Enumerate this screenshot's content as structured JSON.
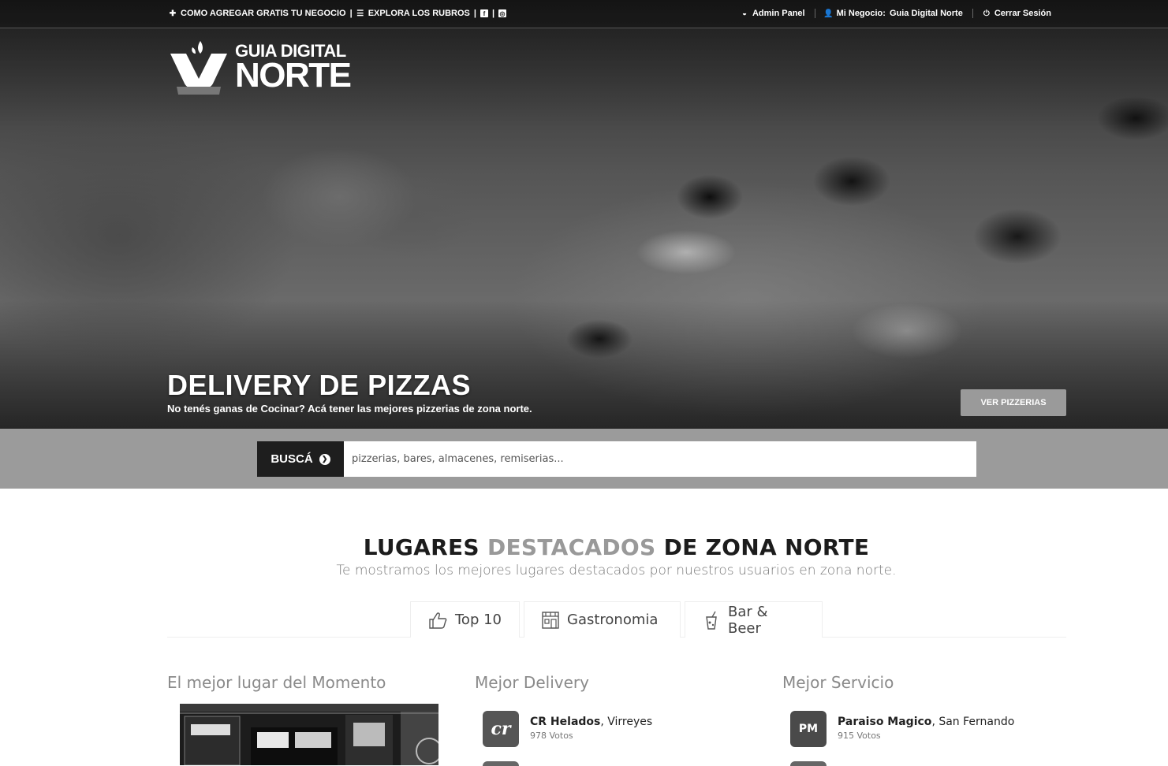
{
  "topbar": {
    "add_business": "COMO AGREGAR GRATIS TU NEGOCIO",
    "explore": "EXPLORA LOS RUBROS",
    "admin_panel": "Admin Panel",
    "my_business_label": "Mi Negocio:",
    "my_business_name": "Guia Digital Norte",
    "logout": "Cerrar Sesión"
  },
  "logo": {
    "line1": "GUIA DIGITAL",
    "line2": "NORTE"
  },
  "hero": {
    "title": "DELIVERY DE PIZZAS",
    "subtitle": "No tenés ganas de Cocinar? Acá tener las mejores pizzerias de zona norte.",
    "button": "VER PIZZERIAS"
  },
  "search": {
    "button": "BUSCÁ",
    "placeholder": "pizzerias, bares, almacenes, remiserias..."
  },
  "section": {
    "title_a": "LUGARES",
    "title_hl": "DESTACADOS",
    "title_b": "DE ZONA NORTE",
    "subtitle": "Te mostramos los mejores lugares destacados por nuestros usuarios en zona norte."
  },
  "tabs": [
    {
      "label": "Top 10",
      "icon": "thumbs-up-icon"
    },
    {
      "label": "Gastronomia",
      "icon": "storefront-icon"
    },
    {
      "label": "Bar & Beer",
      "icon": "drink-icon"
    }
  ],
  "columns": {
    "moment": {
      "heading": "El mejor lugar del Momento"
    },
    "delivery": {
      "heading": "Mejor Delivery",
      "items": [
        {
          "name": "CR Helados",
          "place": ", Virreyes",
          "votes": "978 Votos",
          "thumb": "cr"
        }
      ]
    },
    "service": {
      "heading": "Mejor Servicio",
      "items": [
        {
          "name": "Paraiso Magico",
          "place": ", San Fernando",
          "votes": "915 Votos",
          "thumb": "PM"
        }
      ]
    }
  },
  "colors": {
    "accent_gray": "#999999",
    "dark": "#1e1e1e",
    "search_band": "#9b9b9b"
  }
}
